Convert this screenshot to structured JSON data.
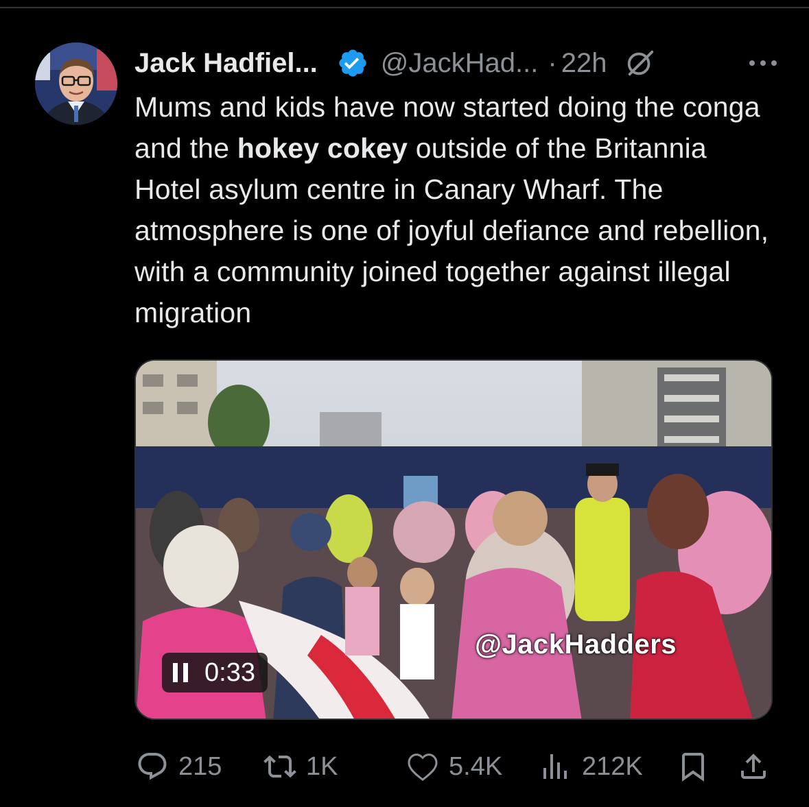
{
  "author": {
    "name": "Jack Hadfiel...",
    "handle": "@JackHad...",
    "separator": "·",
    "time": "22h"
  },
  "tweet": {
    "text_before": "Mums and kids have now started doing the conga and the ",
    "text_bold": "hokey cokey",
    "text_after": " outside of the Britannia Hotel asylum centre in Canary Wharf. The atmosphere is one of joyful defiance and rebellion, with a community joined together against illegal migration"
  },
  "media": {
    "watermark": "@JackHadders",
    "duration": "0:33",
    "playing": true
  },
  "actions": {
    "replies": "215",
    "reposts": "1K",
    "likes": "5.4K",
    "views": "212K"
  },
  "colors": {
    "background": "#000000",
    "text": "#e7e9ea",
    "muted": "#8b9196",
    "verified": "#1d9bf0"
  },
  "icons": [
    "verified-badge-icon",
    "grok-icon",
    "more-icon",
    "pause-icon",
    "reply-icon",
    "repost-icon",
    "like-icon",
    "views-icon",
    "bookmark-icon",
    "share-icon"
  ]
}
